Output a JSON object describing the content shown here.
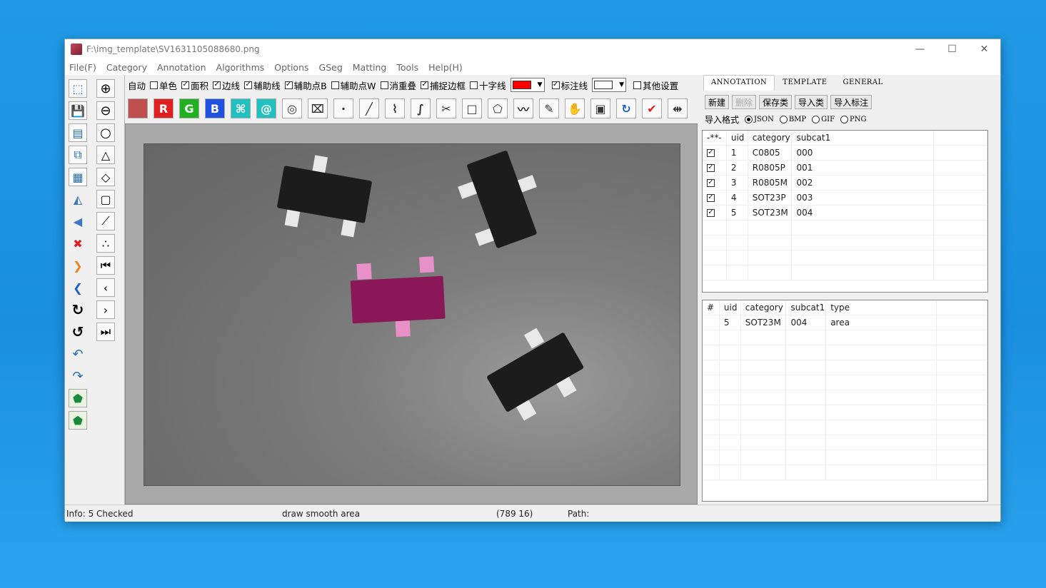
{
  "window": {
    "title": "F:\\img_template\\SV1631105088680.png",
    "minimize": "—",
    "maximize": "☐",
    "close": "✕"
  },
  "menu": [
    "File(F)",
    "Category",
    "Annotation",
    "Algorithms",
    "Options",
    "GSeg",
    "Matting",
    "Tools",
    "Help(H)"
  ],
  "left_toolbar": {
    "col1": [
      "cursor-icon",
      "save-icon",
      "edit-icon",
      "copy-icon",
      "paste-icon",
      "flip-h-icon",
      "flip-v-icon",
      "delete-icon",
      "next-icon",
      "prev-icon",
      "redo-icon",
      "undo-icon",
      "back-icon",
      "forward-icon",
      "polygon-icon",
      "polygon2-icon"
    ],
    "col2": [
      "zoom-in-icon",
      "zoom-out-icon",
      "circle-icon",
      "add-node-icon",
      "add-shape-icon",
      "add-rect-icon",
      "path-icon",
      "points-icon",
      "first-icon",
      "prev-page-icon",
      "next-page-icon",
      "last-icon"
    ]
  },
  "options": [
    {
      "label": "自动",
      "checked": null
    },
    {
      "label": "单色",
      "checked": false
    },
    {
      "label": "面积",
      "checked": true
    },
    {
      "label": "边线",
      "checked": true
    },
    {
      "label": "辅助线",
      "checked": true
    },
    {
      "label": "辅助点B",
      "checked": true
    },
    {
      "label": "辅助点W",
      "checked": false
    },
    {
      "label": "消重叠",
      "checked": false
    },
    {
      "label": "捕捉边框",
      "checked": true
    },
    {
      "label": "十字线",
      "checked": false
    }
  ],
  "color1": "#ff0000",
  "option_label_line": "标注线",
  "option_label_other": "其他设置",
  "icon_row": [
    {
      "name": "photo-icon",
      "glyph": "",
      "bg": "#c0504d"
    },
    {
      "name": "red-channel-icon",
      "glyph": "R",
      "bg": "#e02020"
    },
    {
      "name": "green-channel-icon",
      "glyph": "G",
      "bg": "#20b020"
    },
    {
      "name": "blue-channel-icon",
      "glyph": "B",
      "bg": "#2050e0"
    },
    {
      "name": "lasso-icon",
      "glyph": "⌘",
      "bg": "#20c0c0"
    },
    {
      "name": "at-icon",
      "glyph": "@",
      "bg": "#20c0c0"
    },
    {
      "name": "spiral-icon",
      "glyph": "◎",
      "bg": "#fafafa"
    },
    {
      "name": "magic-icon",
      "glyph": "⌧",
      "bg": "#fafafa"
    },
    {
      "name": "point-icon",
      "glyph": "·",
      "bg": "#fafafa"
    },
    {
      "name": "line-icon",
      "glyph": "╱",
      "bg": "#fafafa"
    },
    {
      "name": "polyline-icon",
      "glyph": "⌇",
      "bg": "#fafafa"
    },
    {
      "name": "curve-icon",
      "glyph": "∫",
      "bg": "#fafafa"
    },
    {
      "name": "scissors-icon",
      "glyph": "✂",
      "bg": "#fafafa"
    },
    {
      "name": "rectangle-icon",
      "glyph": "□",
      "bg": "#fafafa"
    },
    {
      "name": "polygon-icon",
      "glyph": "⬠",
      "bg": "#fafafa"
    },
    {
      "name": "freehand-icon",
      "glyph": "〰",
      "bg": "#fafafa"
    },
    {
      "name": "brush-icon",
      "glyph": "✎",
      "bg": "#fafafa"
    },
    {
      "name": "hand-icon",
      "glyph": "✋",
      "bg": "#fafafa"
    },
    {
      "name": "paste-box-icon",
      "glyph": "▣",
      "bg": "#fafafa"
    },
    {
      "name": "rotate-icon",
      "glyph": "↻",
      "bg": "#fafafa"
    },
    {
      "name": "check-icon",
      "glyph": "✔",
      "bg": "#fafafa"
    },
    {
      "name": "split-icon",
      "glyph": "⇹",
      "bg": "#fafafa"
    }
  ],
  "right": {
    "tabs": [
      "ANNOTATION",
      "TEMPLATE",
      "GENERAL"
    ],
    "buttons": [
      "新建",
      "删除",
      "保存类",
      "导入类",
      "导入标注"
    ],
    "import_label": "导入格式",
    "formats": [
      {
        "label": "JSON",
        "on": true
      },
      {
        "label": "BMP",
        "on": false
      },
      {
        "label": "GIF",
        "on": false
      },
      {
        "label": "PNG",
        "on": false
      }
    ],
    "cat_headers": [
      "-**-",
      "uid",
      "category",
      "subcat1"
    ],
    "cat_rows": [
      {
        "uid": "1",
        "category": "C0805",
        "subcat1": "000"
      },
      {
        "uid": "2",
        "category": "R0805P",
        "subcat1": "001"
      },
      {
        "uid": "3",
        "category": "R0805M",
        "subcat1": "002"
      },
      {
        "uid": "4",
        "category": "SOT23P",
        "subcat1": "003"
      },
      {
        "uid": "5",
        "category": "SOT23M",
        "subcat1": "004"
      }
    ],
    "ann_headers": [
      "#",
      "uid",
      "category",
      "subcat1",
      "type"
    ],
    "ann_rows": [
      {
        "idx": "",
        "uid": "5",
        "category": "SOT23M",
        "subcat1": "004",
        "type": "area"
      }
    ]
  },
  "status": {
    "info": "Info: 5 Checked",
    "mode": "draw smooth area",
    "coords": "(789  16)",
    "path": "Path:"
  }
}
